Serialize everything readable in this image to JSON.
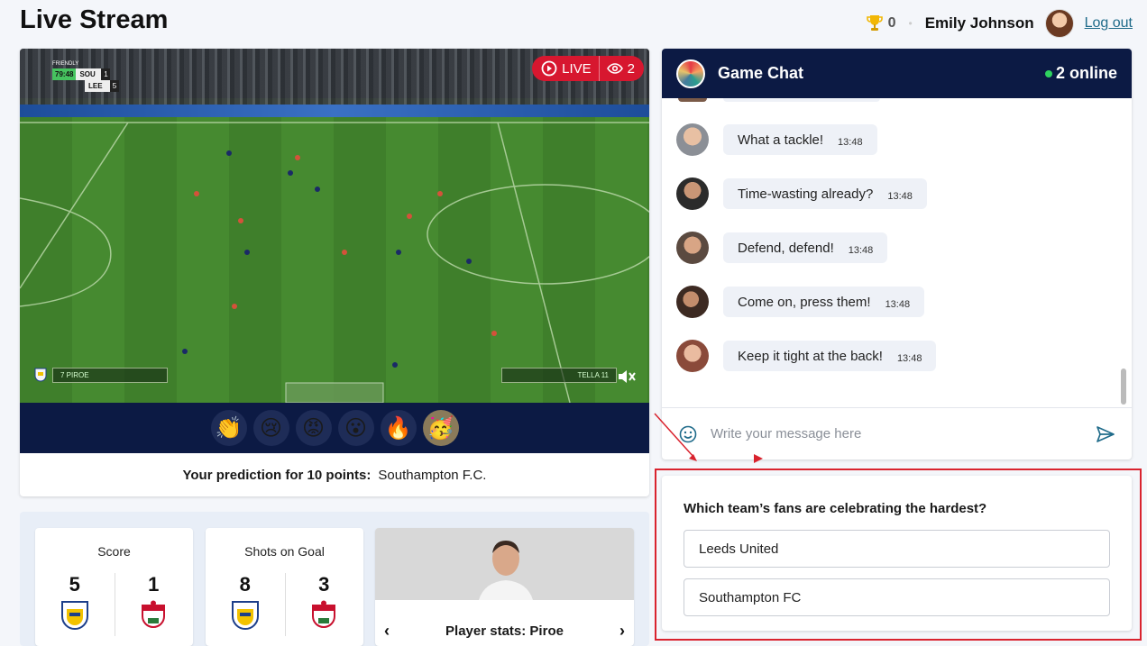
{
  "header": {
    "title": "Live Stream",
    "points": "0",
    "username": "Emily Johnson",
    "logout_label": "Log out"
  },
  "video": {
    "scorebug": {
      "competition": "FRIENDLY",
      "clock": "79:48",
      "home_code": "SOU",
      "home_score": "1",
      "away_code": "LEE",
      "away_score": "5"
    },
    "live_label": "LIVE",
    "viewer_count": "2",
    "left_player_tag": "7 PIROE",
    "right_player_tag": "TELLA 11"
  },
  "reactions": [
    {
      "emoji": "👏",
      "name": "clap"
    },
    {
      "emoji": "😢",
      "name": "cry"
    },
    {
      "emoji": "😡",
      "name": "angry"
    },
    {
      "emoji": "😮",
      "name": "surprised"
    },
    {
      "emoji": "🔥",
      "name": "fire"
    },
    {
      "emoji": "🥳",
      "name": "party"
    }
  ],
  "prediction": {
    "label": "Your prediction for 10 points:",
    "value": "Southampton F.C."
  },
  "stats": {
    "score": {
      "title": "Score",
      "home": "5",
      "away": "1"
    },
    "shots": {
      "title": "Shots on Goal",
      "home": "8",
      "away": "3"
    },
    "player": {
      "title": "Player stats: Piroe"
    }
  },
  "chat": {
    "title": "Game Chat",
    "online": "2 online",
    "messages": [
      {
        "text": "What a tackle!",
        "time": "13:48"
      },
      {
        "text": "Time-wasting already?",
        "time": "13:48"
      },
      {
        "text": "Defend, defend!",
        "time": "13:48"
      },
      {
        "text": "Come on, press them!",
        "time": "13:48"
      },
      {
        "text": "Keep it tight at the back!",
        "time": "13:48"
      }
    ],
    "input_placeholder": "Write your message here"
  },
  "poll": {
    "question": "Which team’s fans are celebrating the hardest?",
    "options": [
      "Leeds United",
      "Southampton FC"
    ]
  },
  "colors": {
    "navy": "#0c1a44",
    "live_red": "#d7172f",
    "highlight_red": "#d9232e",
    "online_green": "#2fd35f"
  }
}
